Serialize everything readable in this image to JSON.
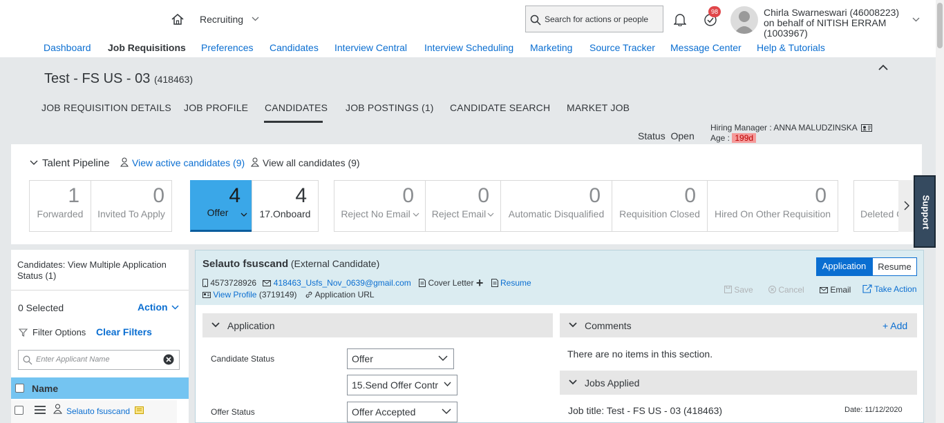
{
  "header": {
    "module": "Recruiting",
    "search_placeholder": "Search for actions or people",
    "notifications_count": "98",
    "user_line1": "Chirla Swarneswari (46008223)",
    "user_line2": "on behalf of NITISH ERRAM",
    "user_line3": "(1003967)"
  },
  "nav": [
    "Dashboard",
    "Job Requisitions",
    "Preferences",
    "Candidates",
    "Interview Central",
    "Interview Scheduling",
    "Marketing",
    "Source Tracker",
    "Message Center",
    "Help & Tutorials"
  ],
  "req": {
    "title": "Test - FS US - 03",
    "id": "(418463)",
    "tabs": [
      "JOB REQUISITION DETAILS",
      "JOB PROFILE",
      "CANDIDATES",
      "JOB POSTINGS (1)",
      "CANDIDATE SEARCH",
      "MARKET JOB"
    ],
    "status_label": "Status",
    "status_value": "Open",
    "hm_label": "Hiring Manager :",
    "hm_value": "ANNA MALUDZINSKA",
    "age_label": "Age :",
    "age_value": "199d"
  },
  "pipeline": {
    "title": "Talent Pipeline",
    "view_active": "View active candidates (9)",
    "view_all": "View all candidates (9)",
    "stages": [
      {
        "num": "1",
        "label": "Forwarded"
      },
      {
        "num": "0",
        "label": "Invited To Apply"
      },
      {
        "num": "4",
        "label": "Offer"
      },
      {
        "num": "4",
        "label": "17.Onboard"
      },
      {
        "num": "0",
        "label": "Reject No Email"
      },
      {
        "num": "0",
        "label": "Reject Email"
      },
      {
        "num": "0",
        "label": "Automatic Disqualified"
      },
      {
        "num": "0",
        "label": "Requisition Closed"
      },
      {
        "num": "0",
        "label": "Hired On Other Requisition"
      },
      {
        "num": "",
        "label": "Deleted C"
      }
    ]
  },
  "left": {
    "title": "Candidates: View Multiple Application Status (1)",
    "selected": "0 Selected",
    "action": "Action",
    "filter": "Filter Options",
    "clear": "Clear Filters",
    "name_placeholder": "Enter Applicant Name",
    "col_name": "Name",
    "candidate": "Selauto fsuscand"
  },
  "candidate": {
    "name": "Selauto fsuscand",
    "type": "(External Candidate)",
    "phone": "4573728926",
    "email": "418463_Usfs_Nov_0639@gmail.com",
    "cover_letter": "Cover Letter",
    "resume_link": "Resume",
    "view_profile": "View Profile",
    "profile_id": "(3719149)",
    "app_url": "Application URL",
    "btn_application": "Application",
    "btn_resume": "Resume",
    "save": "Save",
    "cancel": "Cancel",
    "email_btn": "Email",
    "take_action": "Take Action"
  },
  "application": {
    "section": "Application",
    "status_label": "Candidate Status",
    "status_value": "Offer",
    "substatus_value": "15.Send Offer Contr",
    "offer_label": "Offer Status",
    "offer_value": "Offer Accepted"
  },
  "comments": {
    "section": "Comments",
    "add": "+ Add",
    "empty": "There are no items in this section."
  },
  "jobs": {
    "section": "Jobs Applied",
    "job_title": "Job title: Test - FS US - 03 (418463)",
    "date": "Date: 11/12/2020"
  },
  "support": "Support"
}
